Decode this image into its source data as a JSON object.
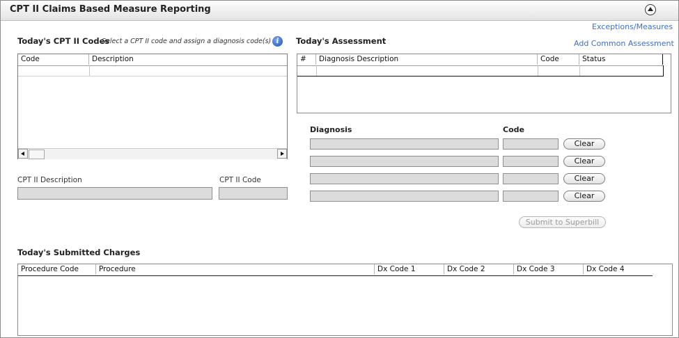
{
  "panel": {
    "title": "CPT II Claims Based Measure Reporting",
    "collapse_icon": "collapse-up-icon"
  },
  "links": {
    "exceptions": "Exceptions/Measures",
    "add_common": "Add Common Assessment"
  },
  "cpt_codes": {
    "heading": "Today's CPT II Codes",
    "hint": "Select a CPT II code and assign a diagnosis code(s)",
    "info_icon": "i",
    "columns": [
      "Code",
      "Description"
    ]
  },
  "cpt_detail": {
    "description_label": "CPT II Description",
    "code_label": "CPT II Code",
    "description_value": "",
    "code_value": ""
  },
  "assessment": {
    "heading": "Today's Assessment",
    "columns": [
      "#",
      "Diagnosis Description",
      "Code",
      "Status"
    ]
  },
  "diagnosis": {
    "diagnosis_label": "Diagnosis",
    "code_label": "Code",
    "clear_label": "Clear",
    "rows": [
      {
        "diagnosis": "",
        "code": ""
      },
      {
        "diagnosis": "",
        "code": ""
      },
      {
        "diagnosis": "",
        "code": ""
      },
      {
        "diagnosis": "",
        "code": ""
      }
    ]
  },
  "submit": {
    "label": "Submit to Superbill"
  },
  "charges": {
    "heading": "Today's Submitted Charges",
    "columns": [
      "Procedure Code",
      "Procedure",
      "Dx Code 1",
      "Dx Code 2",
      "Dx Code 3",
      "Dx Code 4"
    ]
  }
}
